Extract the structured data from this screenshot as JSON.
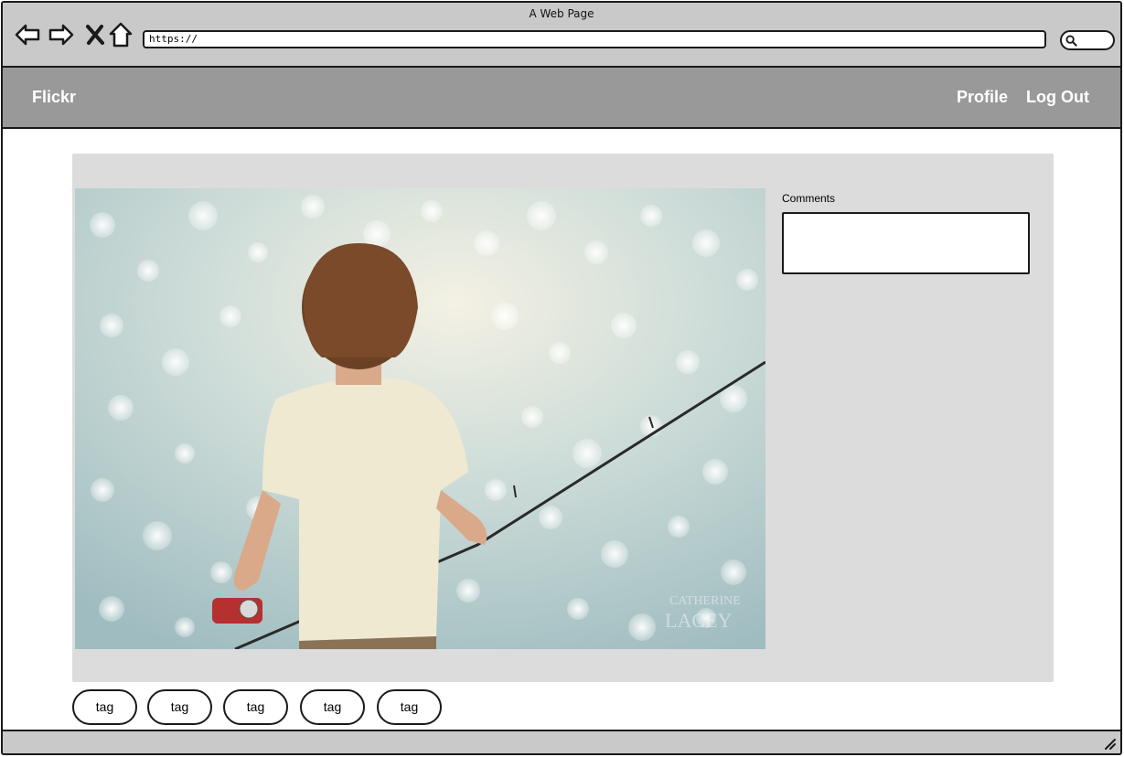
{
  "window": {
    "title": "A Web Page"
  },
  "browser": {
    "url": "https://",
    "icons": [
      "back-arrow-icon",
      "forward-arrow-icon",
      "close-x-icon",
      "home-icon",
      "search-icon"
    ]
  },
  "header": {
    "brand": "Flickr",
    "links": {
      "profile": "Profile",
      "logout": "Log Out"
    },
    "background": "#999999"
  },
  "photo": {
    "description_icon": "photo-image",
    "watermark": "CATHERINE LACEY"
  },
  "comments": {
    "label": "Comments"
  },
  "tags": [
    "tag",
    "tag",
    "tag",
    "tag",
    "tag"
  ],
  "colors": {
    "panel": "#dcdcdc",
    "chrome": "#c9c9c9",
    "nav_text": "#ffffff"
  }
}
